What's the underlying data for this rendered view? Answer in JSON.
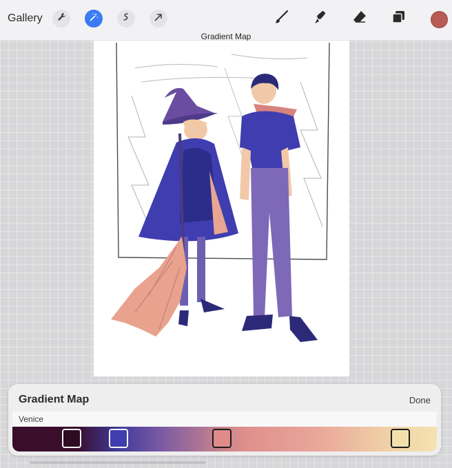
{
  "toolbar": {
    "gallery_label": "Gallery",
    "left_tools": [
      "wrench-icon",
      "magic-wand-icon",
      "selection-icon",
      "transform-arrow-icon"
    ],
    "right_tools": [
      "brush-icon",
      "smudge-icon",
      "eraser-icon",
      "layers-icon"
    ],
    "active_color": "#b85b55"
  },
  "mode": {
    "label": "Gradient Map"
  },
  "panel": {
    "title": "Gradient Map",
    "done_label": "Done",
    "preset_name": "Venice",
    "gradient_stops": [
      {
        "color": "#2d0c22"
      },
      {
        "color": "#3f3db0"
      },
      {
        "color": "#e08a8a"
      },
      {
        "color": "#f2e0ac"
      }
    ]
  }
}
